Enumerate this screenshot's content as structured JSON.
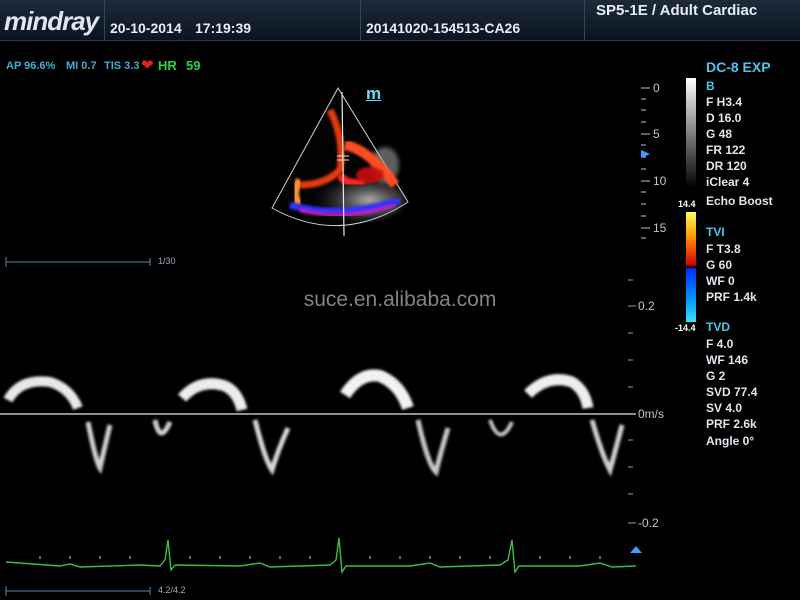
{
  "header": {
    "logo": "mindray",
    "date": "20-10-2014",
    "time": "17:19:39",
    "patient_id": "20141020-154513-CA26",
    "probe_exam": "SP5-1E / Adult Cardiac"
  },
  "status": {
    "ap": "AP 96.6%",
    "mi": "MI 0.7",
    "tis": "TIS 3.3",
    "hr_label": "HR",
    "hr_value": "59"
  },
  "mode_button": "m",
  "right_panel": {
    "model": "DC-8 EXP",
    "b_mode": {
      "title": "B",
      "items": [
        "F H3.4",
        "D 16.0",
        "G 48",
        "FR 122",
        "DR 120",
        "iClear 4",
        "Echo Boost"
      ]
    },
    "tvi": {
      "title": "TVI",
      "items": [
        "F T3.8",
        "G 60",
        "WF 0",
        "PRF 1.4k"
      ]
    },
    "tvd": {
      "title": "TVD",
      "items": [
        "F 4.0",
        "WF 146",
        "G 2",
        "SVD 77.4",
        "SV 4.0",
        "PRF 2.6k",
        "Angle  0°"
      ]
    }
  },
  "color_bar": {
    "max": "14.4",
    "min": "-14.4"
  },
  "depth_scale": [
    "0",
    "5",
    "10",
    "15"
  ],
  "velocity_scale": {
    "top": "0.2",
    "zero": "0m/s",
    "bottom": "-0.2"
  },
  "frame_counter": "1/30",
  "cine_counter": "4.2/4.2",
  "watermark": "suce.en.alibaba.com",
  "colors": {
    "accent_cyan": "#49c6ee",
    "hr_green": "#30d040",
    "heart_red": "#e02020",
    "ecg_green": "#3ac040"
  }
}
